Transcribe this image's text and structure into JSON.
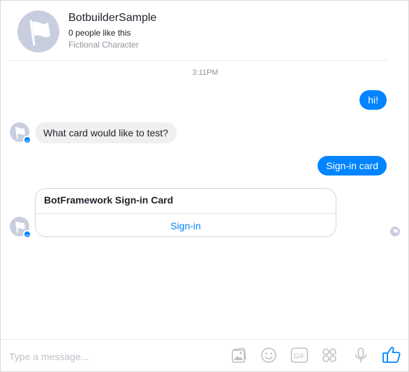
{
  "header": {
    "page_name": "BotbuilderSample",
    "likes": "0 people like this",
    "category": "Fictional Character"
  },
  "conversation": {
    "timestamp": "3:11PM",
    "messages": [
      {
        "from": "user",
        "text": "hi!"
      },
      {
        "from": "bot",
        "text": "What card would like to test?"
      },
      {
        "from": "user",
        "text": "Sign-in card"
      }
    ],
    "card": {
      "title": "BotFramework Sign-in Card",
      "button_label": "Sign-in"
    }
  },
  "composer": {
    "placeholder": "Type a message...",
    "tools": [
      "photo-icon",
      "emoji-icon",
      "gif-icon",
      "games-icon",
      "microphone-icon",
      "thumbs-up-icon"
    ]
  },
  "colors": {
    "accent": "#0084ff",
    "incoming_bubble": "#f1f0f0",
    "avatar_bg": "#c9cedf",
    "muted_text": "#90949c"
  }
}
